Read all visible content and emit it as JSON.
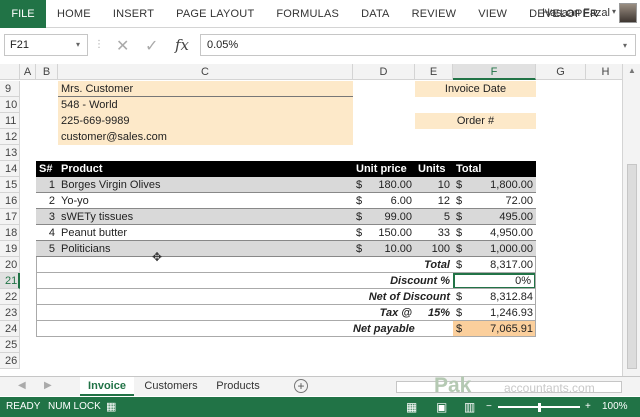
{
  "ribbon": {
    "file": "FILE",
    "tabs": [
      "HOME",
      "INSERT",
      "PAGE LAYOUT",
      "FORMULAS",
      "DATA",
      "REVIEW",
      "VIEW",
      "DEVELOPER"
    ],
    "user": "Hasaan Fazal"
  },
  "formula_bar": {
    "name_box": "F21",
    "fx": "fx",
    "value": "0.05%"
  },
  "columns": [
    "A",
    "B",
    "C",
    "D",
    "E",
    "F",
    "G",
    "H"
  ],
  "rows": [
    "9",
    "10",
    "11",
    "12",
    "13",
    "14",
    "15",
    "16",
    "17",
    "18",
    "19",
    "20",
    "21",
    "22",
    "23",
    "24",
    "25",
    "26"
  ],
  "customer": {
    "name": "Mrs. Customer",
    "address": "548 - World",
    "phone": "225-669-9989",
    "email": "customer@sales.com"
  },
  "meta": {
    "invoice_date": "Invoice Date",
    "order": "Order #"
  },
  "table": {
    "headers": [
      "S#",
      "Product",
      "Unit price",
      "Units",
      "Total"
    ],
    "currency": "$",
    "items": [
      {
        "n": "1",
        "product": "Borges Virgin Olives",
        "price": "180.00",
        "units": "10",
        "total": "1,800.00"
      },
      {
        "n": "2",
        "product": "Yo-yo",
        "price": "6.00",
        "units": "12",
        "total": "72.00"
      },
      {
        "n": "3",
        "product": "sWETy tissues",
        "price": "99.00",
        "units": "5",
        "total": "495.00"
      },
      {
        "n": "4",
        "product": "Peanut butter",
        "price": "150.00",
        "units": "33",
        "total": "4,950.00"
      },
      {
        "n": "5",
        "product": "Politicians",
        "price": "10.00",
        "units": "100",
        "total": "1,000.00"
      }
    ]
  },
  "summary": {
    "total_label": "Total",
    "total_value": "8,317.00",
    "discount_label": "Discount %",
    "discount_value": "0%",
    "net_label": "Net of Discount",
    "net_value": "8,312.84",
    "tax_label": "Tax @",
    "tax_rate": "15%",
    "tax_value": "1,246.93",
    "payable_label": "Net payable",
    "payable_value": "7,065.91"
  },
  "sheets": [
    "Invoice",
    "Customers",
    "Products"
  ],
  "watermark": {
    "a": "Pak",
    "b": "accountants.com"
  },
  "status": {
    "ready": "READY",
    "numlock": "NUM LOCK",
    "zoom": "100%"
  },
  "colors": {
    "accent": "#217346",
    "peach": "#fde9c9",
    "peach_dark": "#fbcf9c"
  }
}
